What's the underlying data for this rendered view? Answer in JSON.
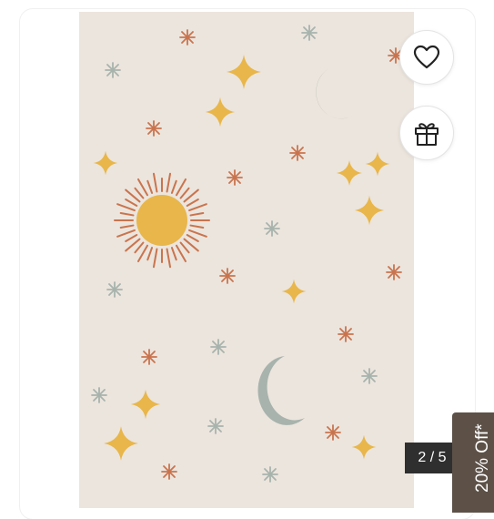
{
  "gallery": {
    "counter": "2 / 5",
    "rug_colors": {
      "base": "#ece5dd",
      "gold": "#e8b64a",
      "rust": "#c9744e",
      "sage": "#a8b3ad"
    }
  },
  "actions": {
    "wishlist_icon": "heart-icon",
    "gift_icon": "gift-icon"
  },
  "promo": {
    "label": "20% Off*",
    "color": "#5d5147"
  }
}
